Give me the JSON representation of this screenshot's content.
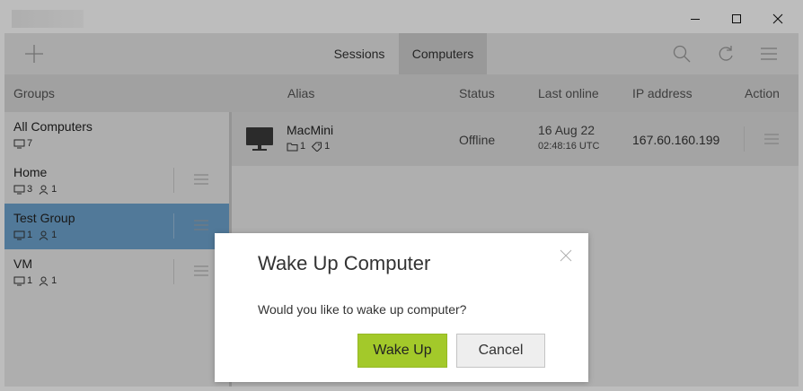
{
  "window": {
    "controls": {
      "minimize": "minimize-icon",
      "maximize": "maximize-icon",
      "close": "close-icon"
    }
  },
  "toolbar": {
    "add_icon": "plus-icon",
    "tabs": [
      {
        "label": "Sessions",
        "active": false
      },
      {
        "label": "Computers",
        "active": true
      }
    ],
    "icons": [
      "search-icon",
      "refresh-icon",
      "hamburger-menu-icon"
    ]
  },
  "columns": {
    "groups": "Groups",
    "alias": "Alias",
    "status": "Status",
    "last_online": "Last online",
    "ip_address": "IP address",
    "action": "Action"
  },
  "groups": [
    {
      "name": "All Computers",
      "computers": "7"
    },
    {
      "name": "Home",
      "computers": "3",
      "users": "1"
    },
    {
      "name": "Test Group",
      "computers": "1",
      "users": "1",
      "selected": true
    },
    {
      "name": "VM",
      "computers": "1",
      "users": "1"
    }
  ],
  "computers": [
    {
      "alias": "MacMini",
      "folders": "1",
      "tags": "1",
      "status": "Offline",
      "last_online_date": "16 Aug 22",
      "last_online_time": "02:48:16 UTC",
      "ip": "167.60.160.199"
    }
  ],
  "dialog": {
    "title": "Wake Up Computer",
    "message": "Would you like to wake up computer?",
    "confirm_label": "Wake Up",
    "cancel_label": "Cancel"
  },
  "colors": {
    "accent_green": "#a3c92a",
    "selected_group": "#6ea4cf"
  }
}
